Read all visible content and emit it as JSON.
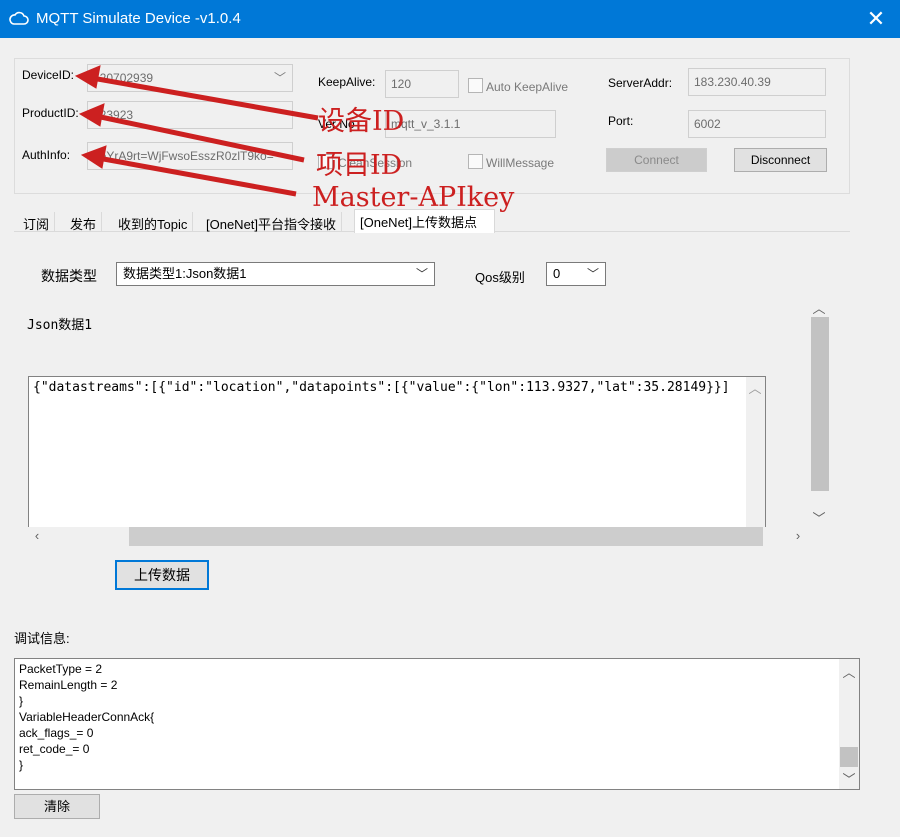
{
  "window": {
    "title": "MQTT Simulate Device  -v1.0.4",
    "close_glyph": "✕"
  },
  "connection": {
    "device_id_label": "DeviceID:",
    "device_id_value": "520702939",
    "product_id_label": "ProductID:",
    "product_id_value": "123923",
    "auth_info_label": "AuthInfo:",
    "auth_info_value": "neYrA9rt=WjFwsoEsszR0zlT9ko=",
    "keepalive_label": "KeepAlive:",
    "keepalive_value": "120",
    "auto_keepalive_label": "Auto KeepAlive",
    "verno_label": "Ver No",
    "verno_value": "mqtt_v_3.1.1",
    "clean_session_label": "CleanSession",
    "will_message_label": "WillMessage",
    "server_addr_label": "ServerAddr:",
    "server_addr_value": "183.230.40.39",
    "port_label": "Port:",
    "port_value": "6002",
    "connect_label": "Connect",
    "disconnect_label": "Disconnect"
  },
  "annotations": {
    "device_id": "设备ID",
    "product_id": "项目ID",
    "auth_info": "Master-APIkey",
    "color": "#cc2020"
  },
  "tabs": [
    {
      "label": "订阅"
    },
    {
      "label": "发布"
    },
    {
      "label": "收到的Topic"
    },
    {
      "label": "[OneNet]平台指令接收"
    },
    {
      "label": "[OneNet]上传数据点",
      "active": true
    }
  ],
  "upload": {
    "data_type_label": "数据类型",
    "data_type_value": "数据类型1:Json数据1",
    "qos_label": "Qos级别",
    "qos_value": "0",
    "section_label": "Json数据1",
    "payload": "{\"datastreams\":[{\"id\":\"location\",\"datapoints\":[{\"value\":{\"lon\":113.9327,\"lat\":35.28149}}]",
    "upload_button": "上传数据"
  },
  "debug": {
    "label": "调试信息:",
    "lines": [
      "PacketType  = 2",
      "RemainLength  = 2",
      "}",
      "VariableHeaderConnAck{",
      "ack_flags_= 0",
      "ret_code_= 0",
      "}"
    ],
    "clear_button": "清除"
  },
  "colors": {
    "titlebar": "#0078d7",
    "accent_focus": "#0078d7"
  }
}
